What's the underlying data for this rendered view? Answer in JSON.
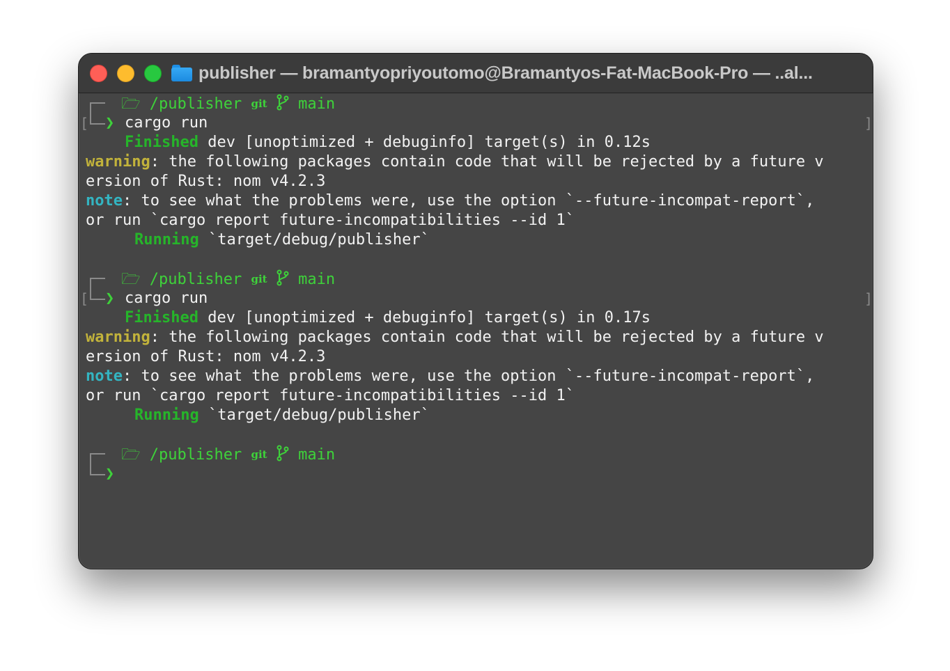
{
  "window": {
    "title": "publisher — bramantyopriyoutomo@Bramantyos-Fat-MacBook-Pro — ..al..."
  },
  "prompt": {
    "path": "/publisher",
    "git_label": "git",
    "branch": "main",
    "chevron": "❯"
  },
  "blocks": [
    {
      "command": "cargo run",
      "finished_label": "Finished",
      "finished_text": " dev [unoptimized + debuginfo] target(s) in 0.12s",
      "warning_label": "warning",
      "warning_text_1": ": the following packages contain code that will be rejected by a future v",
      "warning_text_2": "ersion of Rust: nom v4.2.3",
      "note_label": "note",
      "note_text_1": ": to see what the problems were, use the option `--future-incompat-report`,",
      "note_text_2": "or run `cargo report future-incompatibilities --id 1`",
      "running_label": "Running",
      "running_text": " `target/debug/publisher`"
    },
    {
      "command": "cargo run",
      "finished_label": "Finished",
      "finished_text": " dev [unoptimized + debuginfo] target(s) in 0.17s",
      "warning_label": "warning",
      "warning_text_1": ": the following packages contain code that will be rejected by a future v",
      "warning_text_2": "ersion of Rust: nom v4.2.3",
      "note_label": "note",
      "note_text_1": ": to see what the problems were, use the option `--future-incompat-report`,",
      "note_text_2": "or run `cargo report future-incompatibilities --id 1`",
      "running_label": "Running",
      "running_text": " `target/debug/publisher`"
    }
  ]
}
